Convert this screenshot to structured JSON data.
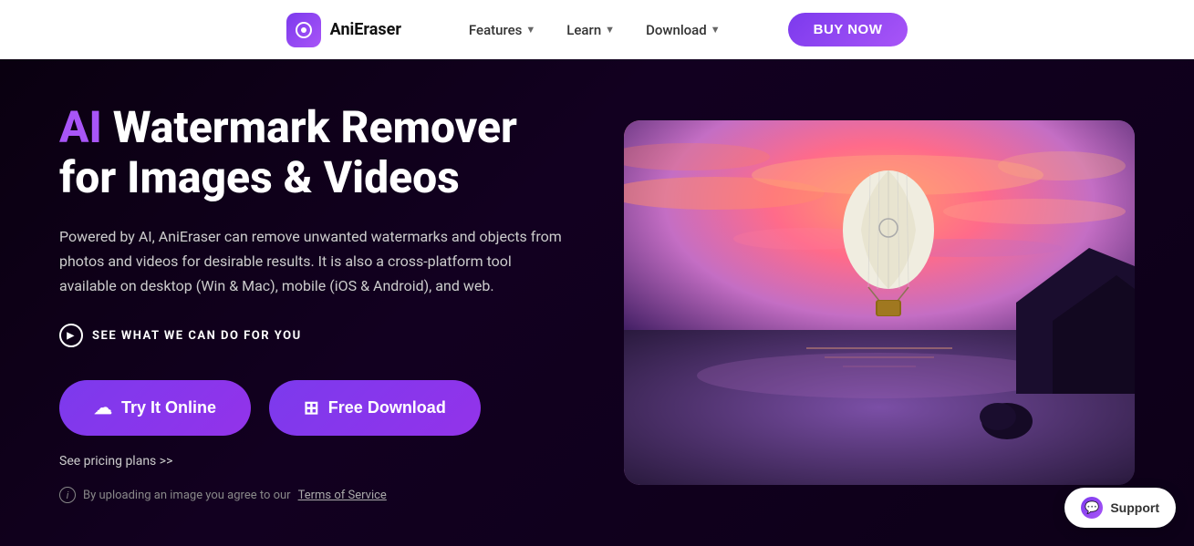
{
  "navbar": {
    "logo_name": "AniEraser",
    "features_label": "Features",
    "learn_label": "Learn",
    "download_label": "Download",
    "buy_now_label": "BUY NOW"
  },
  "hero": {
    "title_ai": "AI",
    "title_rest": " Watermark Remover for Images & Videos",
    "description": "Powered by AI, AniEraser can remove unwanted watermarks and objects from photos and videos for desirable results. It is also a cross-platform tool available on desktop (Win & Mac), mobile (iOS & Android), and web.",
    "watch_label": "SEE WHAT WE CAN DO FOR YOU",
    "try_online_label": "Try It Online",
    "free_download_label": "Free Download",
    "pricing_label": "See pricing plans >>",
    "terms_text": "By uploading an image you agree to our",
    "tos_label": "Terms of Service"
  },
  "support": {
    "label": "Support"
  }
}
